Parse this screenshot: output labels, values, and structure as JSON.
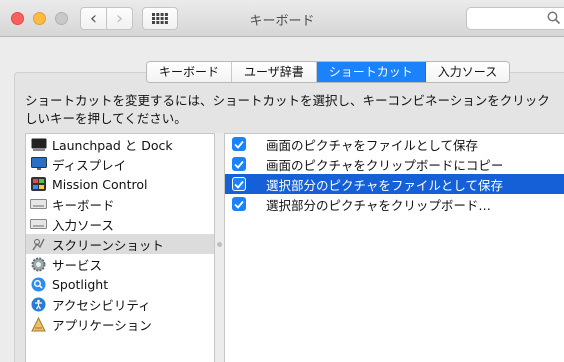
{
  "window": {
    "title": "キーボード"
  },
  "toolbar": {
    "back": "‹",
    "forward": "›"
  },
  "tabs": [
    {
      "label": "キーボード",
      "active": false
    },
    {
      "label": "ユーザ辞書",
      "active": false
    },
    {
      "label": "ショートカット",
      "active": true
    },
    {
      "label": "入力ソース",
      "active": false
    }
  ],
  "description": {
    "line1": "ショートカットを変更するには、ショートカットを選択し、キーコンビネーションをクリック",
    "line2": "しいキーを押してください。"
  },
  "left_list": {
    "items": [
      {
        "label": "Launchpad と Dock",
        "icon": "launchpad-icon",
        "selected": false
      },
      {
        "label": "ディスプレイ",
        "icon": "display-icon",
        "selected": false
      },
      {
        "label": "Mission Control",
        "icon": "mission-control-icon",
        "selected": false
      },
      {
        "label": "キーボード",
        "icon": "keyboard-icon",
        "selected": false
      },
      {
        "label": "入力ソース",
        "icon": "input-source-icon",
        "selected": false
      },
      {
        "label": "スクリーンショット",
        "icon": "screenshot-icon",
        "selected": true
      },
      {
        "label": "サービス",
        "icon": "gear-icon",
        "selected": false
      },
      {
        "label": "Spotlight",
        "icon": "spotlight-icon",
        "selected": false
      },
      {
        "label": "アクセシビリティ",
        "icon": "accessibility-icon",
        "selected": false
      },
      {
        "label": "アプリケーション",
        "icon": "app-store-icon",
        "selected": false
      }
    ]
  },
  "right_list": {
    "items": [
      {
        "label": "画面のピクチャをファイルとして保存",
        "checked": true,
        "selected": false
      },
      {
        "label": "画面のピクチャをクリップボードにコピー",
        "checked": true,
        "selected": false
      },
      {
        "label": "選択部分のピクチャをファイルとして保存",
        "checked": true,
        "selected": true
      },
      {
        "label": "選択部分のピクチャをクリップボード…",
        "checked": true,
        "selected": false
      }
    ]
  },
  "colors": {
    "accent": "#1a82fb",
    "selection": "#1560d6"
  }
}
